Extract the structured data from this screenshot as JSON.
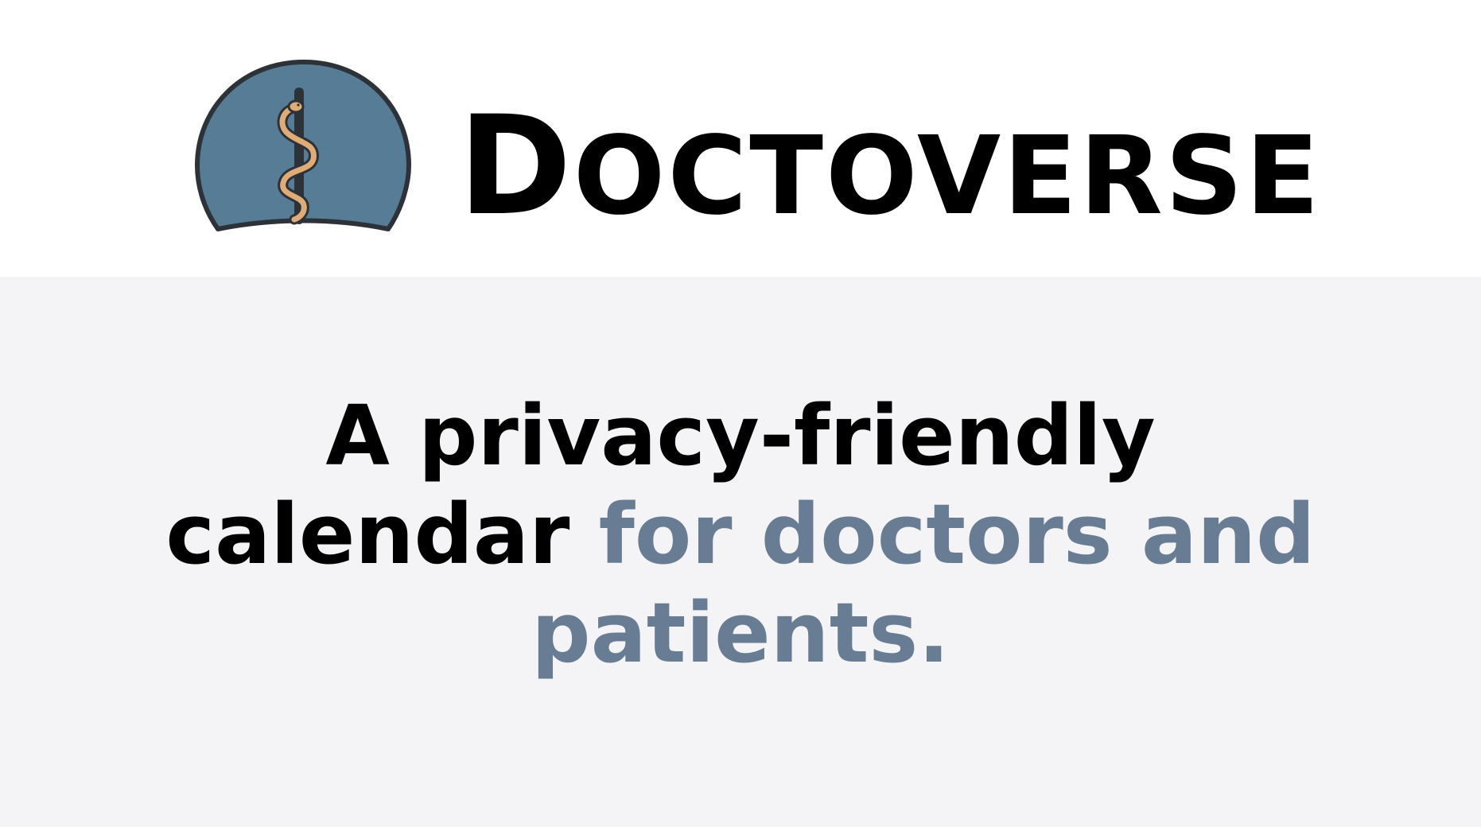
{
  "brand": {
    "first_letter": "D",
    "rest": "OCTOVERSE",
    "logo_icon": "rod-of-asclepius-icon"
  },
  "hero": {
    "tagline_part1": "A privacy-friendly calendar",
    "tagline_part2": "for doctors and patients."
  },
  "colors": {
    "header_bg": "#ffffff",
    "page_bg": "#f4f4f6",
    "logo_dome": "#567c96",
    "logo_outline": "#2d3238",
    "snake": "#e0ac76",
    "accent_text": "#687d93",
    "primary_text": "#000000"
  }
}
